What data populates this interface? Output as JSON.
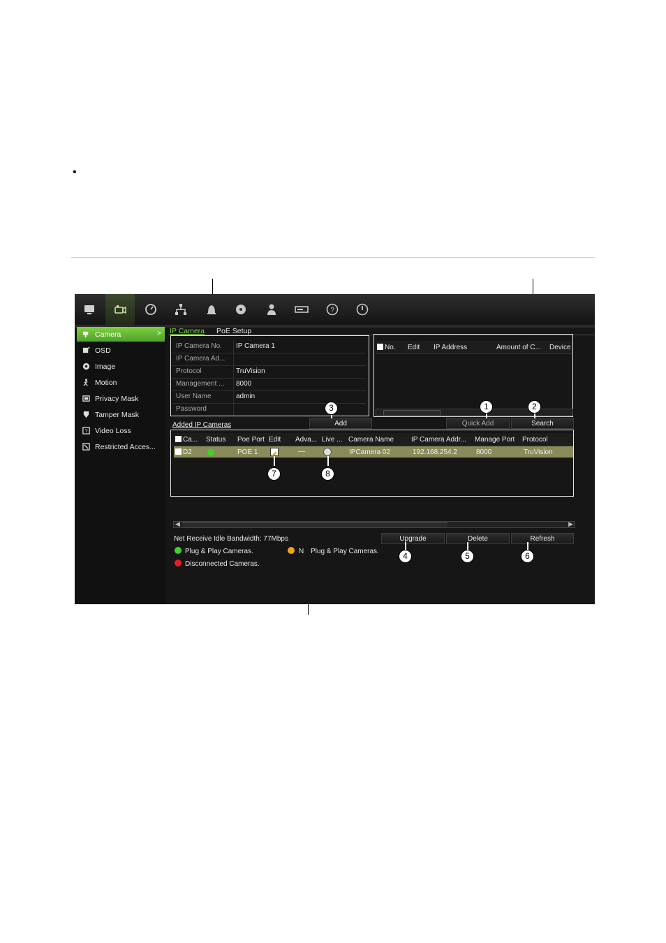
{
  "toolbar": {
    "icons": [
      "monitor-icon",
      "camera-icon",
      "clock-icon",
      "network-icon",
      "alarm-icon",
      "hdd-icon",
      "user-icon",
      "device-icon",
      "help-icon",
      "power-icon"
    ]
  },
  "sidebar": {
    "items": [
      {
        "label": "Camera",
        "icon": "camera-icon"
      },
      {
        "label": "OSD",
        "icon": "osd-icon"
      },
      {
        "label": "Image",
        "icon": "image-icon"
      },
      {
        "label": "Motion",
        "icon": "motion-icon"
      },
      {
        "label": "Privacy Mask",
        "icon": "privacy-mask-icon"
      },
      {
        "label": "Tamper Mask",
        "icon": "tamper-mask-icon"
      },
      {
        "label": "Video Loss",
        "icon": "video-loss-icon"
      },
      {
        "label": "Restricted Acces...",
        "icon": "restricted-access-icon"
      }
    ],
    "active_arrow": ">"
  },
  "tabs": [
    "IP Camera",
    "PoE Setup"
  ],
  "form": {
    "rows": [
      {
        "label": "IP Camera No.",
        "value": "IP Camera 1"
      },
      {
        "label": "IP Camera Ad...",
        "value": ""
      },
      {
        "label": "Protocol",
        "value": "TruVision"
      },
      {
        "label": "Management ...",
        "value": "8000"
      },
      {
        "label": "User Name",
        "value": "admin"
      },
      {
        "label": "Password",
        "value": ""
      }
    ]
  },
  "search_table": {
    "headers": [
      "No.",
      "Edit",
      "IP Address",
      "Amount of C...",
      "Device"
    ]
  },
  "buttons": {
    "add": "Add",
    "quick_add": "Quick Add",
    "search": "Search",
    "upgrade": "Upgrade",
    "delete": "Delete",
    "refresh": "Refresh"
  },
  "added": {
    "title": "Added IP Cameras",
    "headers": [
      "Ca...",
      "Status",
      "Poe Port",
      "Edit",
      "Adva...",
      "Live ...",
      "Camera Name",
      "IP Camera Addr...",
      "Manage Port",
      "Protocol"
    ],
    "rows": [
      {
        "channel": "D2",
        "status_color": "#3fd12a",
        "poe_port": "POE 1",
        "advanced": "—",
        "camera_name": "IPCamera 02",
        "ip": "192.168.254.2",
        "port": "8000",
        "protocol": "TruVision"
      }
    ]
  },
  "bandwidth": "Net Receive Idle Bandwidth: 77Mbps",
  "legend": {
    "plug_play": "Plug & Play Cameras.",
    "no_plug_prefix": "N",
    "no_plug_suffix": "Plug & Play Cameras.",
    "disconnected": "Disconnected Cameras.",
    "colors": {
      "green": "#3fd12a",
      "orange": "#f2a40e",
      "red": "#e02020"
    }
  },
  "callouts": [
    "1",
    "2",
    "3",
    "4",
    "5",
    "6",
    "7",
    "8"
  ],
  "bullet": "•"
}
